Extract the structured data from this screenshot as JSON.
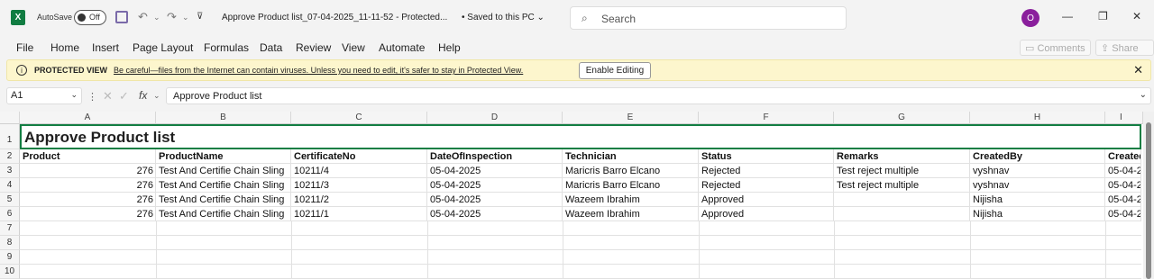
{
  "app": {
    "logo": "X",
    "autosave_label": "AutoSave",
    "autosave_state": "Off"
  },
  "title": {
    "doc_name": "Approve Product list_07-04-2025_11-11-52  -  Protected...",
    "save_status": "• Saved to this PC"
  },
  "search": {
    "placeholder": "Search"
  },
  "user": {
    "initial": "O"
  },
  "menu": [
    "File",
    "Home",
    "Insert",
    "Page Layout",
    "Formulas",
    "Data",
    "Review",
    "View",
    "Automate",
    "Help"
  ],
  "ribbon_buttons": {
    "comments": "Comments",
    "share": "Share"
  },
  "protected_view": {
    "title": "PROTECTED VIEW",
    "message": "Be careful—files from the Internet can contain viruses. Unless you need to edit, it's safer to stay in Protected View.",
    "button": "Enable Editing"
  },
  "formula_bar": {
    "name_box": "A1",
    "fx": "fx",
    "value": "Approve Product list"
  },
  "columns": [
    "A",
    "B",
    "C",
    "D",
    "E",
    "F",
    "G",
    "H",
    "I"
  ],
  "row_numbers": [
    "1",
    "2",
    "3",
    "4",
    "5",
    "6",
    "7",
    "8",
    "9",
    "10"
  ],
  "sheet": {
    "title": "Approve Product list",
    "headers": [
      "Product",
      "ProductName",
      "CertificateNo",
      "DateOfInspection",
      "Technician",
      "Status",
      "Remarks",
      "CreatedBy",
      "Created"
    ],
    "rows": [
      [
        "276",
        "Test And Certifie Chain Sling",
        "10211/4",
        "05-04-2025",
        "Maricris Barro Elcano",
        "Rejected",
        "Test reject multiple",
        "vyshnav",
        "05-04-2"
      ],
      [
        "276",
        "Test And Certifie Chain Sling",
        "10211/3",
        "05-04-2025",
        "Maricris Barro Elcano",
        "Rejected",
        "Test reject multiple",
        "vyshnav",
        "05-04-2"
      ],
      [
        "276",
        "Test And Certifie Chain Sling",
        "10211/2",
        "05-04-2025",
        "Wazeem Ibrahim",
        "Approved",
        "",
        "Nijisha",
        "05-04-2"
      ],
      [
        "276",
        "Test And Certifie Chain Sling",
        "10211/1",
        "05-04-2025",
        "Wazeem Ibrahim",
        "Approved",
        "",
        "Nijisha",
        "05-04-2"
      ]
    ]
  },
  "colors": {
    "accent": "#137e43",
    "protected_bg": "#fdf6cd",
    "avatar": "#8a1f9c"
  }
}
